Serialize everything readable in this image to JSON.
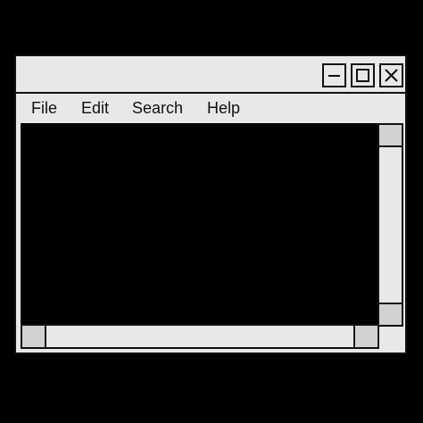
{
  "menu": {
    "file": "File",
    "edit": "Edit",
    "search": "Search",
    "help": "Help"
  },
  "titlebar": {
    "minimize_icon": "minimize-icon",
    "maximize_icon": "maximize-icon",
    "close_icon": "close-icon"
  },
  "colors": {
    "background": "#000000",
    "window": "#e8e8e8",
    "border": "#111111",
    "scroll_button": "#d2d2d2",
    "content": "#000000"
  }
}
